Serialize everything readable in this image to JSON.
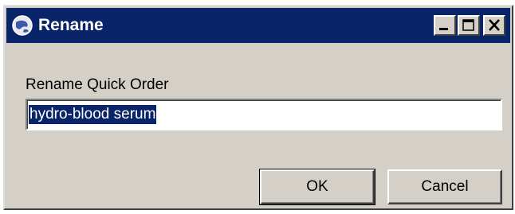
{
  "window": {
    "title": "Rename",
    "title_icon": "globe-icon",
    "controls": [
      "minimize-icon",
      "maximize-icon",
      "close-icon"
    ],
    "titlebar_color": "#0a246a",
    "face_color": "#d4d0c8"
  },
  "form": {
    "label": "Rename Quick Order",
    "name_value": "hydro-blood serum",
    "selection_color": "#0a246a"
  },
  "buttons": {
    "ok_label": "OK",
    "cancel_label": "Cancel"
  }
}
